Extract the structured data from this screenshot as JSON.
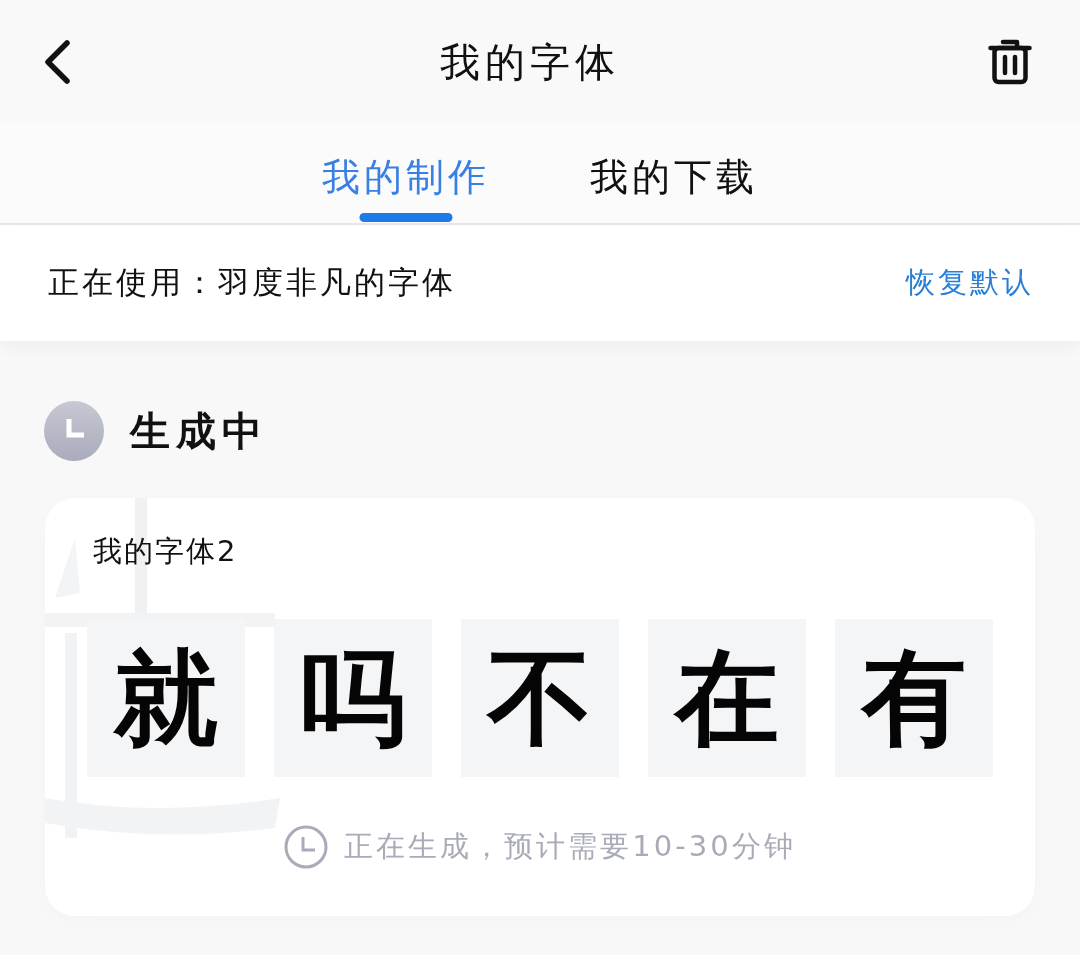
{
  "header": {
    "title": "我的字体"
  },
  "tabs": [
    {
      "label": "我的制作",
      "selected": true
    },
    {
      "label": "我的下载",
      "selected": false
    }
  ],
  "current_font": {
    "label": "正在使用：羽度非凡的字体",
    "action": "恢复默认"
  },
  "section": {
    "title": "生成中"
  },
  "font_card": {
    "name": "我的字体2",
    "preview_glyphs": [
      "就",
      "吗",
      "不",
      "在",
      "有"
    ],
    "status": "正在生成，预计需要10-30分钟"
  }
}
